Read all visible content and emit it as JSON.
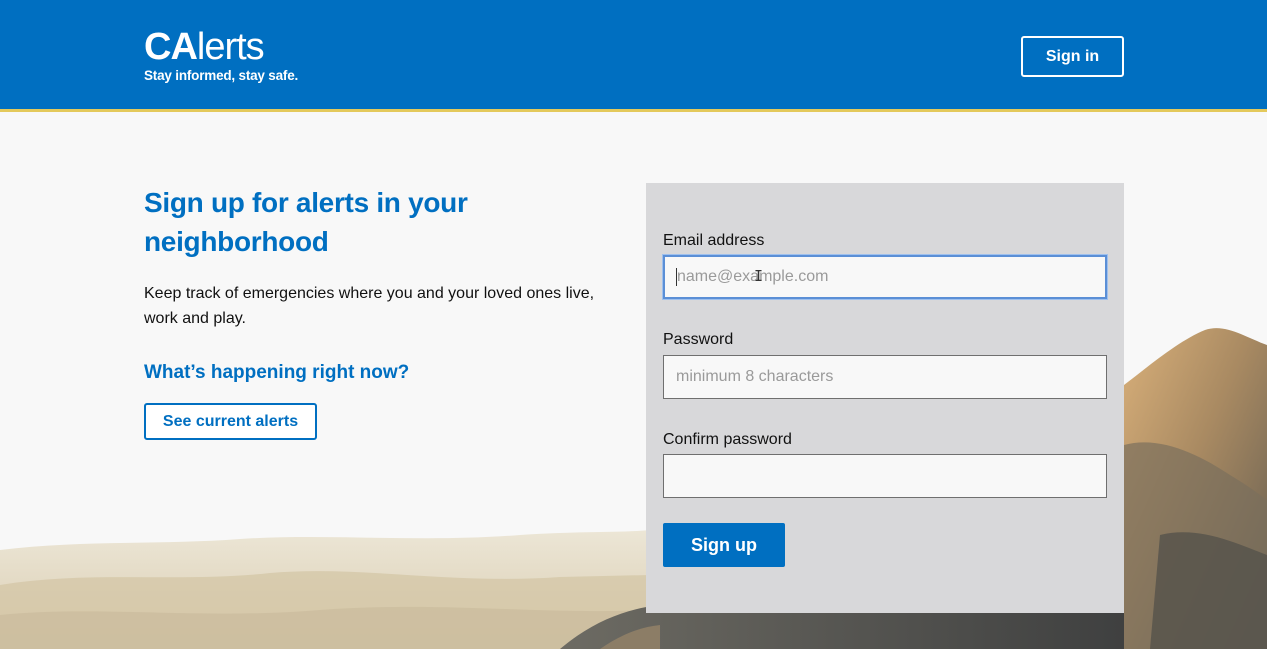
{
  "header": {
    "brand_bold": "CA",
    "brand_regular": "lerts",
    "tagline": "Stay informed, stay safe.",
    "signin_label": "Sign in",
    "bg_color": "#006fc1",
    "accent_color": "#e4c95b"
  },
  "intro": {
    "heading": "Sign up for alerts in your neighborhood",
    "description": "Keep track of emergencies where you and your loved ones live, work and play.",
    "subheading": "What’s happening right now?",
    "see_alerts_label": "See current alerts"
  },
  "form": {
    "email_label": "Email address",
    "email_placeholder": "name@example.com",
    "email_value": "",
    "password_label": "Password",
    "password_placeholder": "minimum 8 characters",
    "password_value": "",
    "confirm_label": "Confirm password",
    "confirm_placeholder": "",
    "confirm_value": "",
    "submit_label": "Sign up"
  }
}
